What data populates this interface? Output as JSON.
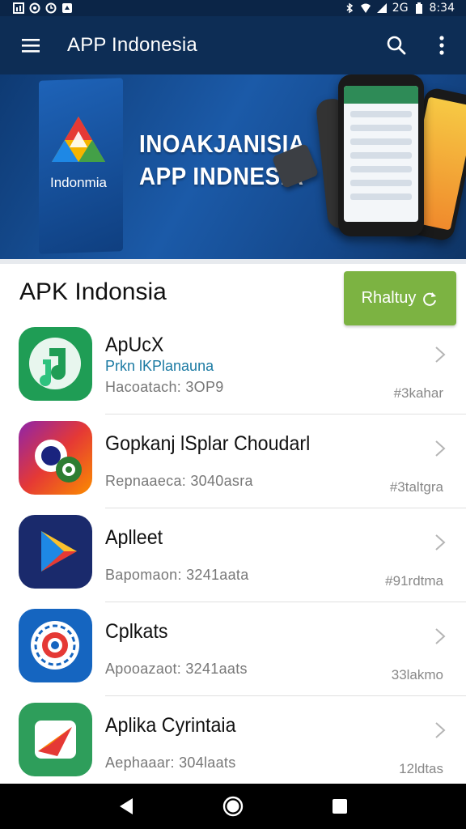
{
  "status_bar": {
    "time": "8:34",
    "network_label": "2G",
    "left_icons": [
      "gallery-icon",
      "settings-icon",
      "clock-icon",
      "notification-icon"
    ],
    "right_icons": [
      "bluetooth-icon",
      "wifi-icon",
      "signal-icon",
      "battery-icon"
    ]
  },
  "app_bar": {
    "title": "APP Indonesia",
    "icons": [
      "menu-icon",
      "search-icon",
      "more-vert-icon"
    ],
    "background": "#0d2d55"
  },
  "banner": {
    "logo_text": "Indonmia",
    "headline_1": "INOAKJANISIA",
    "headline_2": "APP INDNESIA"
  },
  "section": {
    "title": "APK Indonsia",
    "action_label": "Rhaltuy",
    "action_color": "#7cb342"
  },
  "apps": [
    {
      "name": "ApUcX",
      "subtitle": "Prkn lKPlanauna",
      "meta": "Hacoatach: 3OP9",
      "tag": "#3kahar",
      "icon": "music-note-icon"
    },
    {
      "name": "Gopkanj lSplar Choudarl",
      "subtitle": "",
      "meta": "Repnaaeca: 3040asra",
      "tag": "#3taltgra",
      "icon": "camera-gear-icon"
    },
    {
      "name": "Aplleet",
      "subtitle": "",
      "meta": "Bapomaon: 3241aata",
      "tag": "#91rdtma",
      "icon": "play-store-icon"
    },
    {
      "name": "Cplkats",
      "subtitle": "",
      "meta": "Apooazaot: 3241aats",
      "tag": "33lakmo",
      "icon": "target-icon"
    },
    {
      "name": "Aplika Cyrintaia",
      "subtitle": "",
      "meta": "Aephaaar: 304laats",
      "tag": "12ldtas",
      "icon": "paper-plane-icon"
    }
  ],
  "nav_bar": {
    "icons": [
      "back-icon",
      "home-icon",
      "recents-icon"
    ]
  }
}
